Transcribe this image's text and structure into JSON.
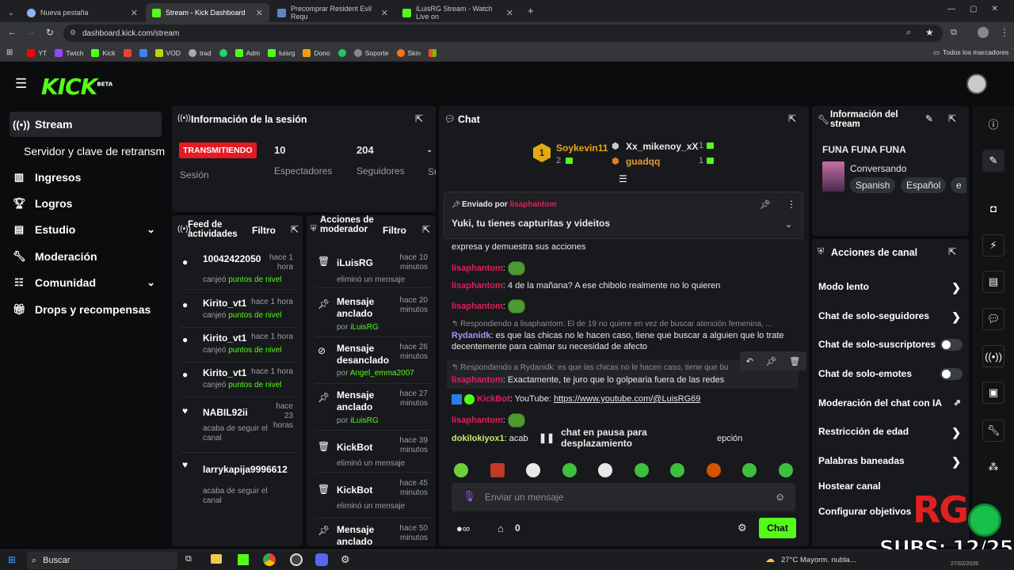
{
  "browser": {
    "tabs": [
      {
        "title": "Nueva pestaña"
      },
      {
        "title": "Stream - Kick Dashboard"
      },
      {
        "title": "Precomprar Resident Evil Requ"
      },
      {
        "title": "iLuisRG Stream - Watch Live on"
      }
    ],
    "url": "dashboard.kick.com/stream",
    "bookmarks": [
      "YT",
      "Twtch",
      "Kick",
      "",
      "",
      "VOD",
      "trad",
      "",
      "Adm",
      "luisrg",
      "Dono",
      "",
      "Soporte",
      "Skin",
      ""
    ],
    "all_bookmarks": "Todos los marcadores"
  },
  "brand": {
    "logo": "KICK",
    "beta": "BETA",
    "accent": "#53fc18"
  },
  "sidebar": {
    "items": [
      {
        "label": "Stream",
        "icon": "broadcast-icon"
      },
      {
        "label": "Servidor y clave de retransm",
        "icon": ""
      },
      {
        "label": "Ingresos",
        "icon": "chart-icon"
      },
      {
        "label": "Logros",
        "icon": "trophy-icon"
      },
      {
        "label": "Estudio",
        "icon": "studio-icon"
      },
      {
        "label": "Moderación",
        "icon": "wrench-icon"
      },
      {
        "label": "Comunidad",
        "icon": "community-icon"
      },
      {
        "label": "Drops y recompensas",
        "icon": "gift-icon"
      }
    ]
  },
  "session": {
    "title": "Información de la sesión",
    "status": "TRANSMITIENDO",
    "status_label": "Sesión",
    "stats": [
      {
        "value": "10",
        "label": "Espectadores"
      },
      {
        "value": "204",
        "label": "Seguidores"
      },
      {
        "value": "-",
        "label": "Su"
      }
    ]
  },
  "feed": {
    "title": "Feed de actividades",
    "filter": "Filtro",
    "items": [
      {
        "name": "10042422050",
        "time": "hace 1 hora",
        "action": "canjeó",
        "highlight": "puntos de nivel"
      },
      {
        "name": "Kirito_vt1",
        "time": "hace 1 hora",
        "action": "canjeó",
        "highlight": "puntos de nivel"
      },
      {
        "name": "Kirito_vt1",
        "time": "hace 1 hora",
        "action": "canjeó",
        "highlight": "puntos de nivel"
      },
      {
        "name": "Kirito_vt1",
        "time": "hace 1 hora",
        "action": "canjeó",
        "highlight": "puntos de nivel"
      },
      {
        "name": "NABIL92ii",
        "time": "hace 23 horas",
        "action": "acaba de seguir el canal",
        "highlight": ""
      },
      {
        "name": "larrykapija9996612",
        "time": "",
        "action": "acaba de seguir el canal",
        "highlight": ""
      }
    ]
  },
  "modactions": {
    "title": "Acciones de moderador",
    "filter": "Filtro",
    "items": [
      {
        "name": "iLuisRG",
        "time": "hace 10 minutos",
        "detail": "eliminó un mensaje",
        "by": "",
        "icon": "trash-icon"
      },
      {
        "name": "Mensaje anclado",
        "time": "hace 20 minutos",
        "detail": "por",
        "by": "iLuisRG",
        "icon": "pin-icon"
      },
      {
        "name": "Mensaje desanclado",
        "time": "hace 26 minutos",
        "detail": "por",
        "by": "Angel_emma2007",
        "icon": "unpin-icon"
      },
      {
        "name": "Mensaje anclado",
        "time": "hace 27 minutos",
        "detail": "por",
        "by": "iLuisRG",
        "icon": "pin-icon"
      },
      {
        "name": "KickBot",
        "time": "hace 39 minutos",
        "detail": "eliminó un mensaje",
        "by": "",
        "icon": "trash-icon"
      },
      {
        "name": "KickBot",
        "time": "hace 45 minutos",
        "detail": "eliminó un mensaje",
        "by": "",
        "icon": "trash-icon"
      },
      {
        "name": "Mensaje anclado",
        "time": "hace 50 minutos",
        "detail": "",
        "by": "",
        "icon": "pin-icon"
      }
    ]
  },
  "chat": {
    "title": "Chat",
    "leaders": [
      {
        "name": "Soykevin11",
        "count": "2"
      },
      {
        "name": "Xx_mikenoy_xX",
        "count": "1"
      },
      {
        "name": "guadqq",
        "count": "1"
      }
    ],
    "pinned": {
      "sent_by_label": "Enviado por",
      "sent_by": "lisaphantom",
      "text": "Yuki, tu tienes capturitas y videitos"
    },
    "messages": [
      {
        "user": "",
        "text": "expresa y demuestra sus acciones"
      },
      {
        "user": "lisaphantom",
        "text": ""
      },
      {
        "user": "lisaphantom",
        "text": "4 de la mañana? A ese chibolo realmente no lo quieren"
      },
      {
        "user": "lisaphantom",
        "text": ""
      },
      {
        "reply": "Respondiendo a lisaphantom: El de 19 no quiere en vez de buscar atención femenina, ...",
        "user": "Rydanidk",
        "text": "es que las chicas no le hacen caso, tiene que buscar a alguien que lo trate decentemente para calmar su necesidad de afecto"
      },
      {
        "reply": "Respondiendo a Rydanidk: es que las chicas no le hacen caso, tiene que bu",
        "user": "lisaphantom",
        "text": "Exactamente, te juro que lo golpearia fuera de las redes"
      },
      {
        "user": "KickBot",
        "text": "YouTube: ",
        "link": "https://www.youtube.com/@LuisRG69"
      },
      {
        "user": "lisaphantom",
        "text": ""
      },
      {
        "user": "dokilokiyox1",
        "text": "acab",
        "tail": "epción"
      }
    ],
    "paused": "chat en pausa para desplazamiento",
    "input_placeholder": "Enviar un mensaje",
    "points": "0",
    "send": "Chat"
  },
  "streaminfo": {
    "title": "Información del stream",
    "stream_title": "FUNA FUNA FUNA",
    "category": "Conversando",
    "tags": [
      "Spanish",
      "Español",
      "e"
    ]
  },
  "channel_actions": {
    "title": "Acciones de canal",
    "items": [
      {
        "label": "Modo lento",
        "kind": "chevron"
      },
      {
        "label": "Chat de solo-seguidores",
        "kind": "chevron"
      },
      {
        "label": "Chat de solo-suscriptores",
        "kind": "toggle"
      },
      {
        "label": "Chat de solo-emotes",
        "kind": "toggle"
      },
      {
        "label": "Moderación del chat con IA",
        "kind": "external"
      },
      {
        "label": "Restricción de edad",
        "kind": "chevron"
      },
      {
        "label": "Palabras baneadas",
        "kind": "chevron"
      },
      {
        "label": "Hostear canal",
        "kind": "none"
      },
      {
        "label": "Configurar objetivos",
        "kind": "none"
      }
    ]
  },
  "overlay": {
    "rg": "RG",
    "subs": "SUBS: 12/25"
  },
  "taskbar": {
    "search": "Buscar",
    "weather": "27°C  Mayorm. nubla...",
    "date": "27/02/2026"
  }
}
